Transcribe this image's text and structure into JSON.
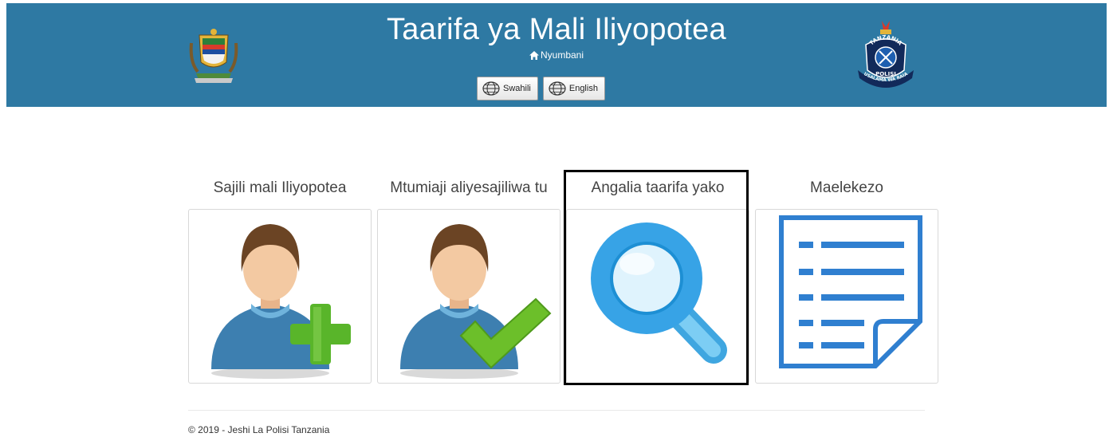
{
  "header": {
    "title": "Taarifa ya Mali Iliyopotea",
    "home_link": "Nyumbani",
    "background_color": "#2e79a3",
    "left_emblem": "tanzania-coat-of-arms",
    "right_emblem": "tanzania-police-badge",
    "right_emblem_text": [
      "TANZANIA",
      "POLISI",
      "USALAMA WA RAIA"
    ]
  },
  "languages": [
    {
      "label": "Swahili",
      "icon": "globe-icon"
    },
    {
      "label": "English",
      "icon": "globe-icon"
    }
  ],
  "tiles": [
    {
      "label": "Sajili mali Iliyopotea",
      "icon": "user-add-icon"
    },
    {
      "label": "Mtumiaji aliyesajiliwa tu",
      "icon": "user-check-icon"
    },
    {
      "label": "Angalia taarifa yako",
      "icon": "search-icon",
      "highlighted": true
    },
    {
      "label": "Maelekezo",
      "icon": "document-list-icon"
    }
  ],
  "footer": {
    "copyright": "© 2019 - Jeshi La Polisi Tanzania"
  }
}
